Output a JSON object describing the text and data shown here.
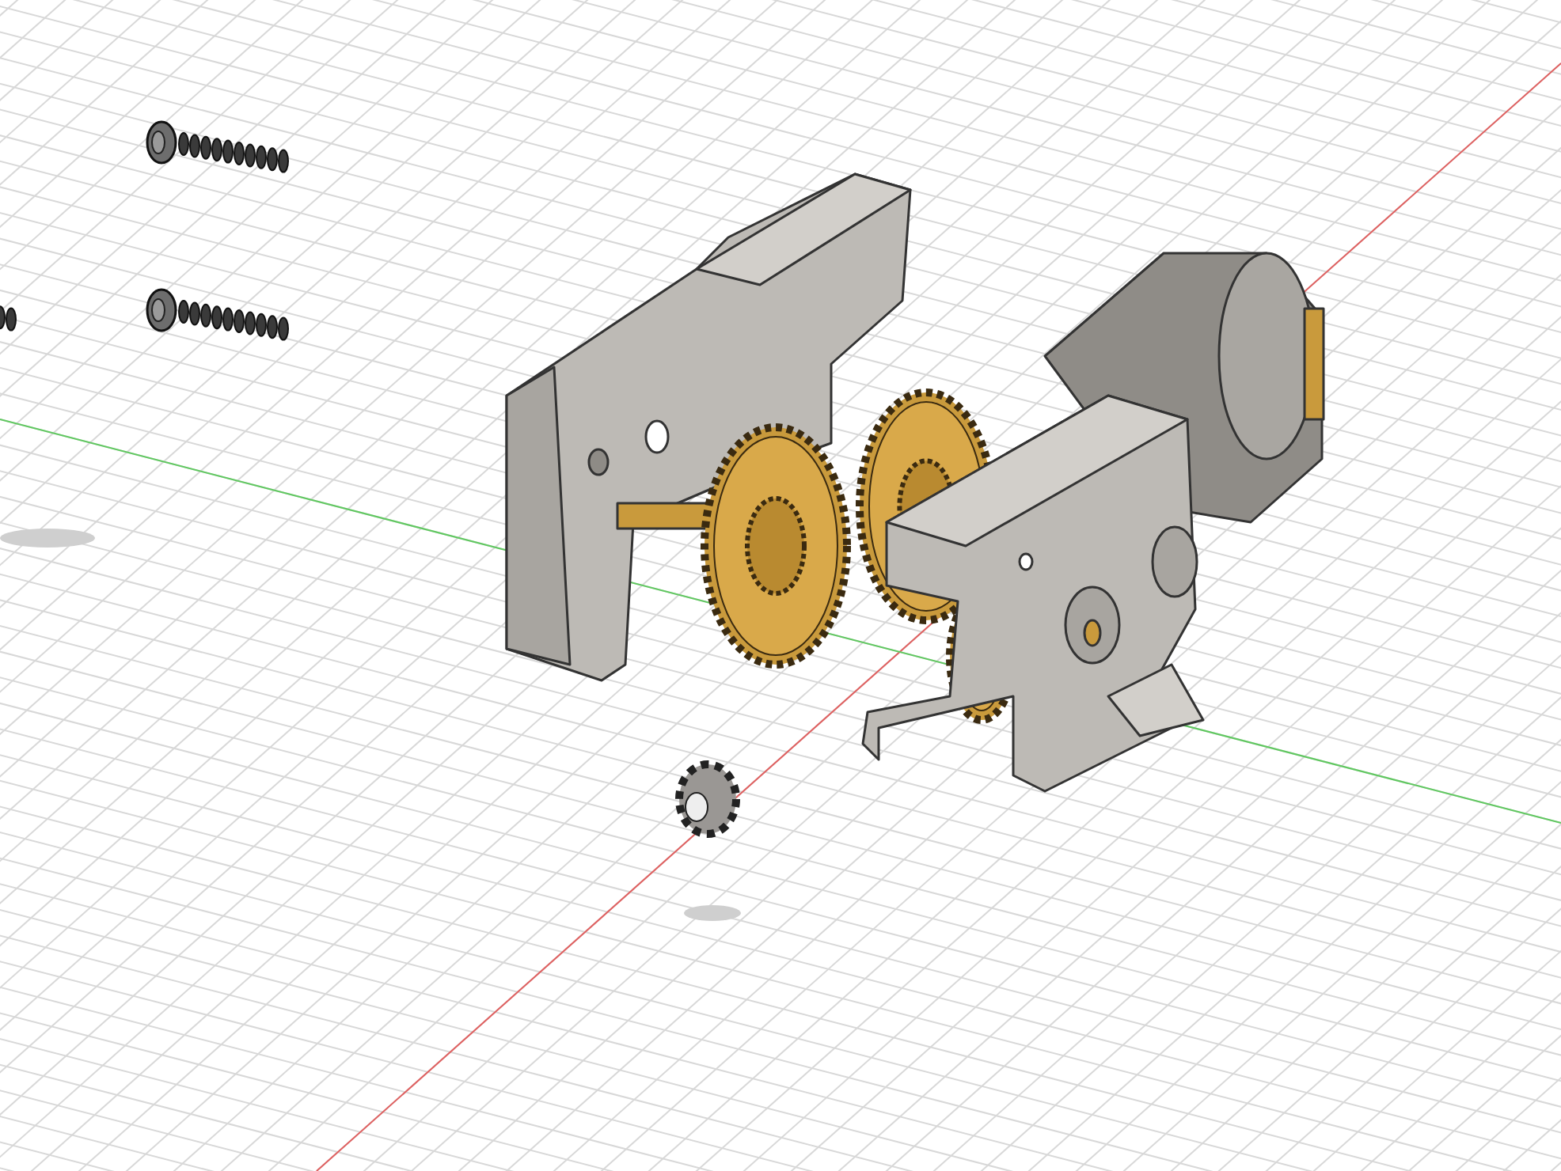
{
  "viewport": {
    "grid": true,
    "axes": [
      {
        "color": "#e06060"
      },
      {
        "color": "#60c860"
      }
    ]
  }
}
